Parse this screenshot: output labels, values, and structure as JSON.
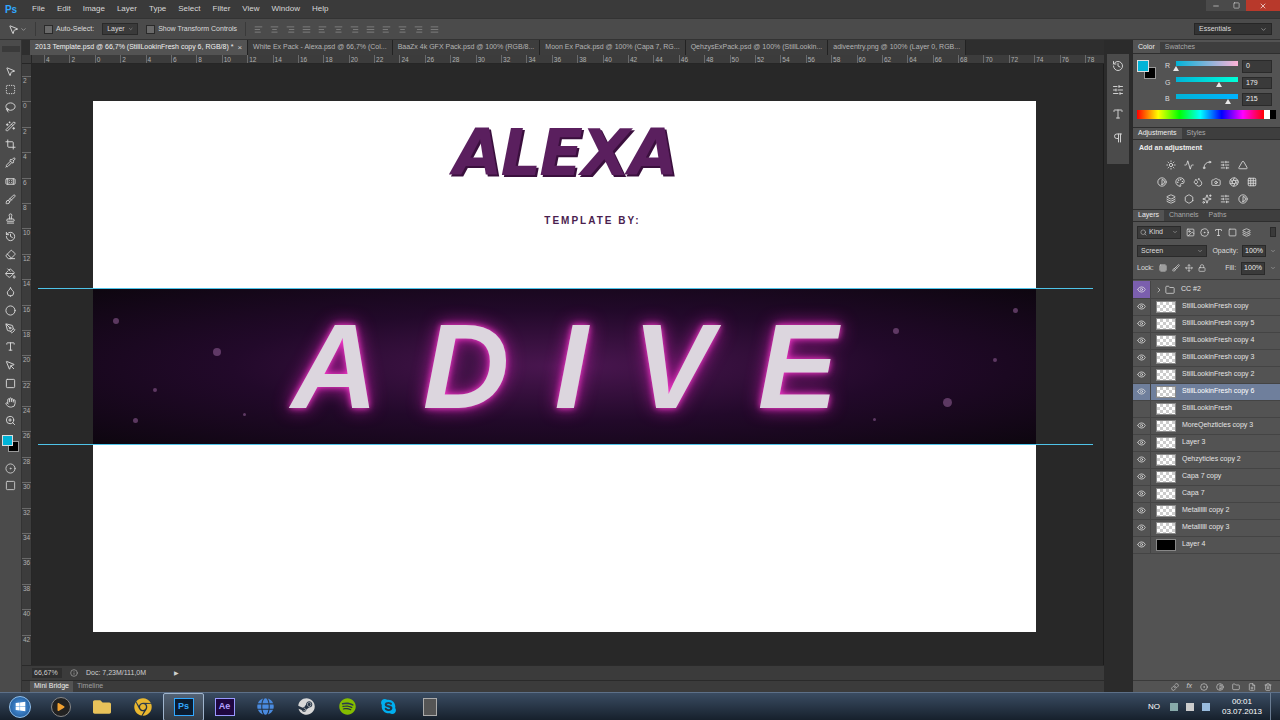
{
  "app": {
    "logo": "Ps"
  },
  "menu": [
    "File",
    "Edit",
    "Image",
    "Layer",
    "Type",
    "Select",
    "Filter",
    "View",
    "Window",
    "Help"
  ],
  "workspace": "Essentials",
  "options_bar": {
    "auto_select": {
      "label": "Auto-Select:",
      "checked": false
    },
    "target": "Layer",
    "transform_controls": {
      "label": "Show Transform Controls",
      "checked": false
    }
  },
  "document_tabs": [
    {
      "label": "2013 Template.psd @ 66,7% (StillLookinFresh copy 6, RGB/8) *",
      "close": "×",
      "selected": true
    },
    {
      "label": "White Ex Pack - Alexa.psd @ 66,7% (Col...",
      "close": "",
      "selected": false
    },
    {
      "label": "BaaZx 4k GFX Pack.psd @ 100% (RGB/8...",
      "close": "",
      "selected": false
    },
    {
      "label": "Moon Ex Pack.psd @ 100% (Capa 7, RG...",
      "close": "",
      "selected": false
    },
    {
      "label": "QehzysExPack.psd @ 100% (StillLookin...",
      "close": "",
      "selected": false
    },
    {
      "label": "adiveentry.png @ 100% (Layer 0, RGB...",
      "close": "",
      "selected": false
    }
  ],
  "rulers": {
    "horizontal": [
      "4",
      "2",
      "0",
      "2",
      "4",
      "6",
      "8",
      "10",
      "12",
      "14",
      "16",
      "18",
      "20",
      "22",
      "24",
      "26",
      "28",
      "30",
      "32",
      "34",
      "36",
      "38",
      "40",
      "42",
      "44",
      "46",
      "48",
      "50",
      "52",
      "54",
      "56",
      "58",
      "60",
      "62",
      "64",
      "66",
      "68",
      "70",
      "72",
      "74",
      "76",
      "78"
    ],
    "vertical": [
      "2",
      "0",
      "2",
      "4",
      "6",
      "8",
      "10",
      "12",
      "14",
      "16",
      "18",
      "20",
      "22",
      "24",
      "26",
      "28",
      "30",
      "32",
      "34",
      "36",
      "38",
      "40",
      "42"
    ]
  },
  "canvas": {
    "logo": "ALEXA",
    "subtitle": "TEMPLATE BY:",
    "banner_text": "ADIVE"
  },
  "status_bar": {
    "zoom": "66,67%",
    "doc": "Doc: 7,23M/111,0M",
    "arrow": "▶"
  },
  "bottom_tabs": [
    {
      "label": "Mini Bridge",
      "selected": true
    },
    {
      "label": "Timeline",
      "selected": false
    }
  ],
  "color_panel": {
    "tabs": [
      {
        "label": "Color",
        "selected": true
      },
      {
        "label": "Swatches",
        "selected": false
      }
    ],
    "foreground": "#00b3d7",
    "background": "#000000",
    "channels": [
      {
        "name": "R",
        "value": "0",
        "level": 0,
        "color": "#ffb3d7"
      },
      {
        "name": "G",
        "value": "179",
        "level": 0.7,
        "color": "#00ffd7"
      },
      {
        "name": "B",
        "value": "215",
        "level": 0.84,
        "color": "#00b3ff"
      }
    ]
  },
  "adjustments_panel": {
    "tabs": [
      {
        "label": "Adjustments",
        "selected": true
      },
      {
        "label": "Styles",
        "selected": false
      }
    ],
    "title": "Add an adjustment"
  },
  "layers_panel": {
    "tabs": [
      {
        "label": "Layers",
        "selected": true
      },
      {
        "label": "Channels",
        "selected": false
      },
      {
        "label": "Paths",
        "selected": false
      }
    ],
    "filter": "Kind",
    "blend_mode": "Screen",
    "opacity_label": "Opacity:",
    "opacity": "100%",
    "lock_label": "Lock:",
    "fill_label": "Fill:",
    "fill": "100%",
    "fx": "fx",
    "layers": [
      {
        "name": "CC #2",
        "kind": "group",
        "visible": true,
        "selected": false,
        "expanded": false,
        "color": "#7b5fae"
      },
      {
        "name": "StillLookinFresh copy",
        "kind": "pixel",
        "visible": true,
        "selected": false,
        "expanded": false,
        "color": ""
      },
      {
        "name": "StillLookinFresh copy 5",
        "kind": "pixel",
        "visible": true,
        "selected": false,
        "expanded": false,
        "color": ""
      },
      {
        "name": "StillLookinFresh copy 4",
        "kind": "pixel",
        "visible": true,
        "selected": false,
        "expanded": false,
        "color": ""
      },
      {
        "name": "StillLookinFresh copy 3",
        "kind": "pixel",
        "visible": true,
        "selected": false,
        "expanded": false,
        "color": ""
      },
      {
        "name": "StillLookinFresh copy 2",
        "kind": "pixel",
        "visible": true,
        "selected": false,
        "expanded": false,
        "color": ""
      },
      {
        "name": "StillLookinFresh copy 6",
        "kind": "pixel",
        "visible": true,
        "selected": true,
        "expanded": false,
        "color": ""
      },
      {
        "name": "StillLookinFresh",
        "kind": "pixel",
        "visible": false,
        "selected": false,
        "expanded": false,
        "color": ""
      },
      {
        "name": "MoreQehzticles copy 3",
        "kind": "pixel",
        "visible": true,
        "selected": false,
        "expanded": false,
        "color": ""
      },
      {
        "name": "Layer 3",
        "kind": "pixel",
        "visible": true,
        "selected": false,
        "expanded": false,
        "color": ""
      },
      {
        "name": "Qehzyticles copy 2",
        "kind": "pixel",
        "visible": true,
        "selected": false,
        "expanded": false,
        "color": ""
      },
      {
        "name": "Capa 7 copy",
        "kind": "pixel",
        "visible": true,
        "selected": false,
        "expanded": false,
        "color": ""
      },
      {
        "name": "Capa 7",
        "kind": "pixel",
        "visible": true,
        "selected": false,
        "expanded": false,
        "color": ""
      },
      {
        "name": "Metallllll copy 2",
        "kind": "pixel",
        "visible": true,
        "selected": false,
        "expanded": false,
        "color": ""
      },
      {
        "name": "Metallllll copy 3",
        "kind": "pixel",
        "visible": true,
        "selected": false,
        "expanded": false,
        "color": ""
      },
      {
        "name": "Layer 4",
        "kind": "fill",
        "visible": true,
        "selected": false,
        "expanded": false,
        "color": "#000000"
      }
    ]
  },
  "taskbar": {
    "apps": [
      {
        "label": "Ps",
        "selected": true
      },
      {
        "label": "Ae",
        "selected": false
      }
    ],
    "language": "NO",
    "time": "00:01",
    "date": "03.07.2013"
  }
}
